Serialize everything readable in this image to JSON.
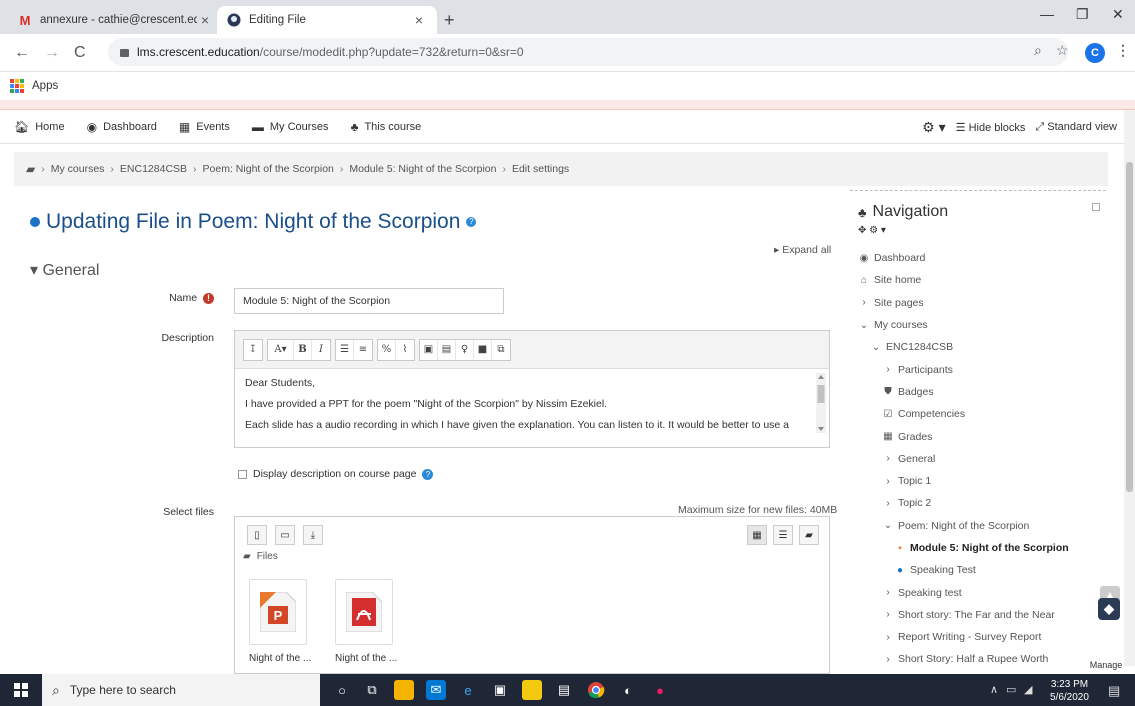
{
  "browser": {
    "tabs": [
      {
        "label": "annexure - cathie@crescent.educ",
        "favicon": "gmail-icon",
        "active": false
      },
      {
        "label": "Editing File",
        "favicon": "moodle-icon",
        "active": true
      }
    ],
    "url_host": "lms.crescent.education",
    "url_path": "/course/modedit.php?update=732&return=0&sr=0",
    "avatar_letter": "C",
    "bookmarks_apps_label": "Apps"
  },
  "topnav": {
    "items": [
      {
        "label": "Home",
        "icon": "home-icon"
      },
      {
        "label": "Dashboard",
        "icon": "dashboard-icon"
      },
      {
        "label": "Events",
        "icon": "calendar-icon"
      },
      {
        "label": "My Courses",
        "icon": "courses-icon"
      },
      {
        "label": "This course",
        "icon": "sitemap-icon"
      }
    ],
    "hide_blocks": "Hide blocks",
    "standard_view": "Standard view"
  },
  "breadcrumb": [
    "My courses",
    "ENC1284CSB",
    "Poem: Night of the Scorpion",
    "Module 5: Night of the Scorpion",
    "Edit settings"
  ],
  "main": {
    "title": "Updating File in Poem: Night of the Scorpion",
    "expand_all": "Expand all",
    "section": "General",
    "name_label": "Name",
    "name_value": "Module 5: Night of the Scorpion",
    "description_label": "Description",
    "description_lines": [
      "Dear Students,",
      "I have provided a PPT for the poem \"Night of the Scorpion\" by Nissim Ezekiel.",
      "Each slide has a audio recording in which I have given the explanation. You can listen to it. It would be better to use a"
    ],
    "display_desc_label": "Display description on course page",
    "select_files_label": "Select files",
    "max_size": "Maximum size for new files: 40MB",
    "files_folder": "Files",
    "files": [
      {
        "name": "Night of the ...",
        "type": "pptx-file-icon"
      },
      {
        "name": "Night of the ...",
        "type": "pdf-file-icon"
      }
    ]
  },
  "navigation": {
    "title": "Navigation",
    "items": [
      {
        "label": "Dashboard",
        "icon": "dashboard-icon",
        "indent": 0,
        "bold": false
      },
      {
        "label": "Site home",
        "icon": "home-icon",
        "indent": 0,
        "bold": false
      },
      {
        "label": "Site pages",
        "icon": "chevron-right-icon",
        "indent": 0,
        "bold": false
      },
      {
        "label": "My courses",
        "icon": "chevron-down-icon",
        "indent": 0,
        "bold": false
      },
      {
        "label": "ENC1284CSB",
        "icon": "chevron-down-icon",
        "indent": 1,
        "bold": false
      },
      {
        "label": "Participants",
        "icon": "chevron-right-icon",
        "indent": 2,
        "bold": false
      },
      {
        "label": "Badges",
        "icon": "shield-icon",
        "indent": 2,
        "bold": false
      },
      {
        "label": "Competencies",
        "icon": "checkbox-icon",
        "indent": 2,
        "bold": false
      },
      {
        "label": "Grades",
        "icon": "table-icon",
        "indent": 2,
        "bold": false
      },
      {
        "label": "General",
        "icon": "chevron-right-icon",
        "indent": 2,
        "bold": false
      },
      {
        "label": "Topic 1",
        "icon": "chevron-right-icon",
        "indent": 2,
        "bold": false
      },
      {
        "label": "Topic 2",
        "icon": "chevron-right-icon",
        "indent": 2,
        "bold": false
      },
      {
        "label": "Poem: Night of the Scorpion",
        "icon": "chevron-down-icon",
        "indent": 2,
        "bold": false
      },
      {
        "label": "Module 5: Night of the Scorpion",
        "icon": "file-icon",
        "indent": 3,
        "bold": true
      },
      {
        "label": "Speaking Test",
        "icon": "quiz-icon",
        "indent": 3,
        "bold": false
      },
      {
        "label": "Speaking test",
        "icon": "chevron-right-icon",
        "indent": 2,
        "bold": false
      },
      {
        "label": "Short story: The Far and the Near",
        "icon": "chevron-right-icon",
        "indent": 2,
        "bold": false
      },
      {
        "label": "Report Writing - Survey Report",
        "icon": "chevron-right-icon",
        "indent": 2,
        "bold": false
      },
      {
        "label": "Short Story: Half a Rupee Worth",
        "icon": "chevron-right-icon",
        "indent": 2,
        "bold": false
      }
    ],
    "manage_label": "Manage"
  },
  "taskbar": {
    "search_placeholder": "Type here to search",
    "time": "3:23 PM",
    "date": "5/6/2020"
  },
  "colors": {
    "title_blue": "#1a4f8a",
    "required_red": "#c0392b",
    "taskbar": "#1f2636"
  }
}
